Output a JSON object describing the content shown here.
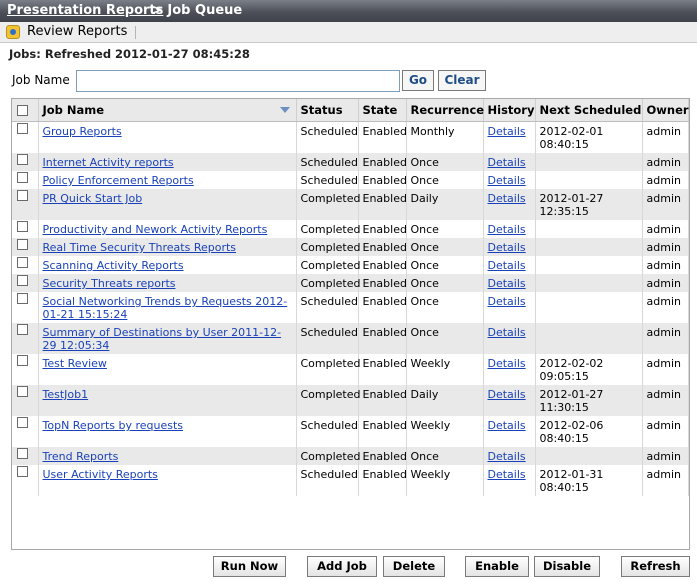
{
  "title": {
    "crumb": "Presentation Reports",
    "current": "> Job Queue"
  },
  "toolbar": {
    "review_label": "Review Reports"
  },
  "status": {
    "refreshed": "Jobs: Refreshed 2012-01-27 08:45:28"
  },
  "search": {
    "label": "Job Name",
    "value": "",
    "go_label": "Go",
    "clear_label": "Clear"
  },
  "table": {
    "columns": [
      "Job Name",
      "Status",
      "State",
      "Recurrence",
      "History",
      "Next Scheduled",
      "Owner"
    ],
    "rows": [
      {
        "name": "Group Reports",
        "status": "Scheduled",
        "state": "Enabled",
        "recurrence": "Monthly",
        "history": "Details",
        "next": [
          "2012-02-01",
          "08:40:15"
        ],
        "owner": "admin"
      },
      {
        "name": "Internet Activity reports",
        "status": "Scheduled",
        "state": "Enabled",
        "recurrence": "Once",
        "history": "Details",
        "next": [],
        "owner": "admin"
      },
      {
        "name": "Policy Enforcement Reports",
        "status": "Scheduled",
        "state": "Enabled",
        "recurrence": "Once",
        "history": "Details",
        "next": [],
        "owner": "admin"
      },
      {
        "name": "PR Quick Start Job",
        "status": "Completed",
        "state": "Enabled",
        "recurrence": "Daily",
        "history": "Details",
        "next": [
          "2012-01-27",
          "12:35:15"
        ],
        "owner": "admin"
      },
      {
        "name": "Productivity and Nework Activity Reports",
        "status": "Completed",
        "state": "Enabled",
        "recurrence": "Once",
        "history": "Details",
        "next": [],
        "owner": "admin"
      },
      {
        "name": "Real Time Security Threats Reports",
        "status": "Completed",
        "state": "Enabled",
        "recurrence": "Once",
        "history": "Details",
        "next": [],
        "owner": "admin"
      },
      {
        "name": "Scanning Activity Reports",
        "status": "Completed",
        "state": "Enabled",
        "recurrence": "Once",
        "history": "Details",
        "next": [],
        "owner": "admin"
      },
      {
        "name": "Security Threats reports",
        "status": "Completed",
        "state": "Enabled",
        "recurrence": "Once",
        "history": "Details",
        "next": [],
        "owner": "admin"
      },
      {
        "name": "Social Networking Trends by Requests 2012-01-21 15:15:24",
        "status": "Scheduled",
        "state": "Enabled",
        "recurrence": "Once",
        "history": "Details",
        "next": [],
        "owner": "admin"
      },
      {
        "name": "Summary of Destinations by User 2011-12-29 12:05:34",
        "status": "Scheduled",
        "state": "Enabled",
        "recurrence": "Once",
        "history": "Details",
        "next": [],
        "owner": "admin"
      },
      {
        "name": "Test Review",
        "status": "Completed",
        "state": "Enabled",
        "recurrence": "Weekly",
        "history": "Details",
        "next": [
          "2012-02-02",
          "09:05:15"
        ],
        "owner": "admin"
      },
      {
        "name": "TestJob1",
        "status": "Completed",
        "state": "Enabled",
        "recurrence": "Daily",
        "history": "Details",
        "next": [
          "2012-01-27",
          "11:30:15"
        ],
        "owner": "admin"
      },
      {
        "name": "TopN Reports by requests",
        "status": "Scheduled",
        "state": "Enabled",
        "recurrence": "Weekly",
        "history": "Details",
        "next": [
          "2012-02-06",
          "08:40:15"
        ],
        "owner": "admin"
      },
      {
        "name": "Trend Reports",
        "status": "Completed",
        "state": "Enabled",
        "recurrence": "Once",
        "history": "Details",
        "next": [],
        "owner": "admin"
      },
      {
        "name": "User Activity Reports",
        "status": "Scheduled",
        "state": "Enabled",
        "recurrence": "Weekly",
        "history": "Details",
        "next": [
          "2012-01-31",
          "08:40:15"
        ],
        "owner": "admin"
      }
    ]
  },
  "buttons": {
    "run_now": "Run Now",
    "add_job": "Add Job",
    "delete": "Delete",
    "enable": "Enable",
    "disable": "Disable",
    "refresh": "Refresh"
  },
  "icons": {
    "toolbar": "review-reports-icon",
    "sort": "sort-descending-icon"
  }
}
